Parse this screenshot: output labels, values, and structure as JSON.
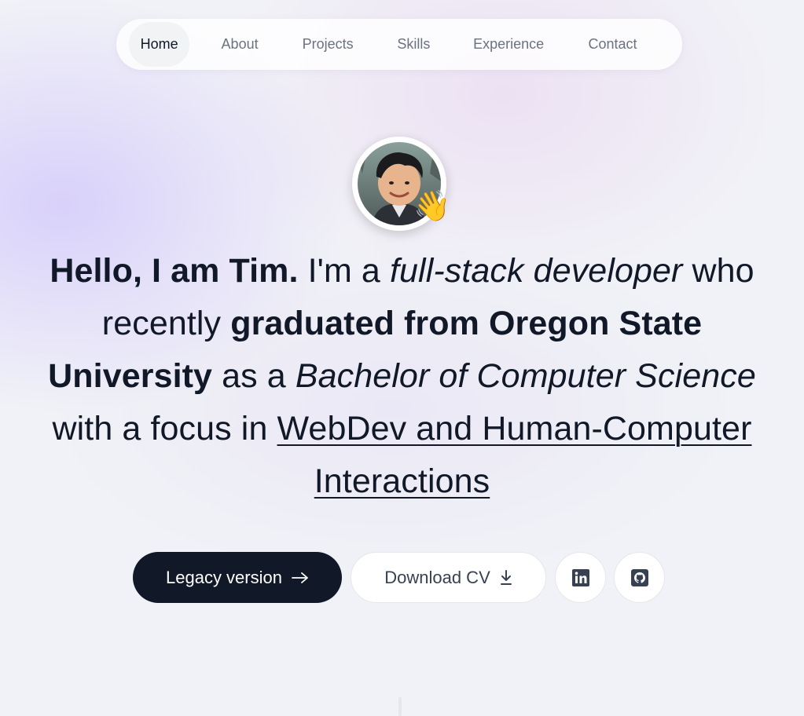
{
  "nav": {
    "items": [
      {
        "label": "Home",
        "active": true
      },
      {
        "label": "About",
        "active": false
      },
      {
        "label": "Projects",
        "active": false
      },
      {
        "label": "Skills",
        "active": false
      },
      {
        "label": "Experience",
        "active": false
      },
      {
        "label": "Contact",
        "active": false
      }
    ]
  },
  "hero": {
    "avatar_emoji": "👋",
    "intro_bold": "Hello, I am Tim.",
    "intro_plain": " I'm a ",
    "role_italic": "full-stack developer",
    "line2_plain": " who recently ",
    "graduated_bold": "graduated from Oregon State University",
    "as_a": " as a ",
    "degree_italic": "Bachelor of Computer Science",
    "focus_plain": " with a focus in ",
    "focus_link": "WebDev and Human-Computer Interactions"
  },
  "actions": {
    "legacy_label": "Legacy version",
    "download_label": "Download CV",
    "linkedin_icon": "linkedin-icon",
    "github_icon": "github-icon"
  },
  "colors": {
    "primary_dark": "#111827",
    "muted_text": "#6b7280",
    "active_tab_bg": "#f1f3f4"
  }
}
